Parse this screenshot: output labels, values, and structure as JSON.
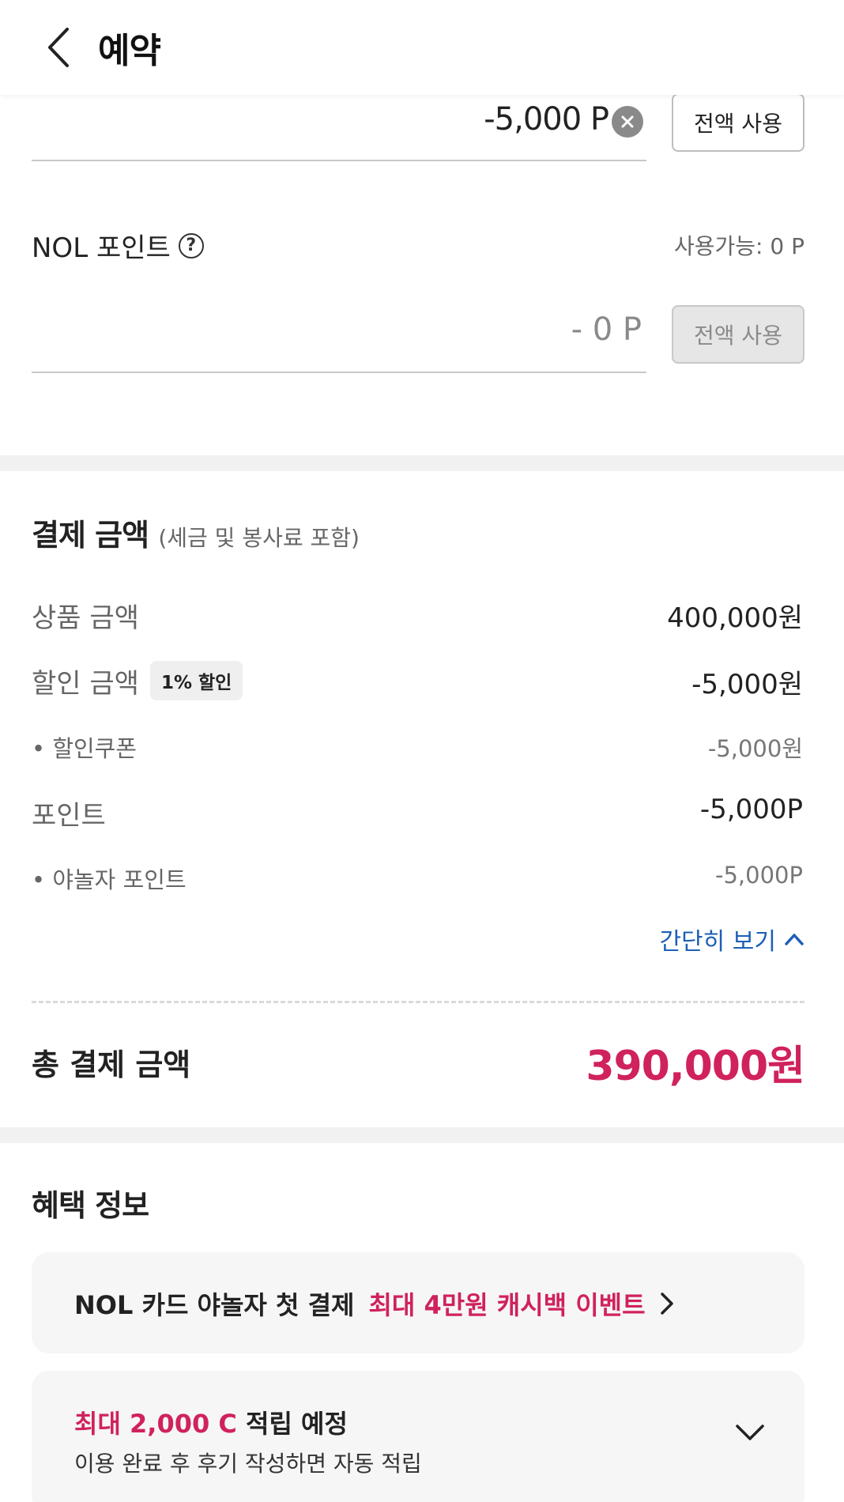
{
  "header": {
    "title": "예약"
  },
  "points": {
    "yanolja_value": "-5,000 P",
    "full_use_label": "전액 사용",
    "nol": {
      "label": "NOL 포인트",
      "available": "사용가능: 0 P",
      "value": "- 0 P",
      "full_use_label": "전액 사용"
    }
  },
  "payment": {
    "title": "결제 금액",
    "subtitle": "(세금 및 봉사료 포함)",
    "lines": {
      "product_label": "상품 금액",
      "product_value": "400,000원",
      "discount_label": "할인 금액",
      "discount_badge": "1% 할인",
      "discount_value": "-5,000원",
      "coupon_label": "• 할인쿠폰",
      "coupon_value": "-5,000원",
      "point_label": "포인트",
      "point_value": "-5,000P",
      "yanolja_point_label": "• 야놀자 포인트",
      "yanolja_point_value": "-5,000P"
    },
    "collapse_label": "간단히 보기",
    "total_label": "총 결제 금액",
    "total_value": "390,000원"
  },
  "benefits": {
    "title": "혜택 정보",
    "card1": {
      "text": "NOL 카드 야놀자 첫 결제",
      "accent": "최대 4만원 캐시백 이벤트"
    },
    "card2": {
      "accent": "최대 2,000 C",
      "text": " 적립 예정",
      "desc": "이용 완료 후 후기 작성하면 자동 적립"
    }
  },
  "icons": {
    "back": "chevron-left-icon",
    "clear": "close-circle-icon",
    "help": "question-circle-icon",
    "collapse": "chevron-up-icon",
    "card1_arrow": "chevron-right-icon",
    "card2_arrow": "chevron-down-icon"
  },
  "colors": {
    "accent": "#d0225d",
    "link": "#1c5fb5"
  }
}
